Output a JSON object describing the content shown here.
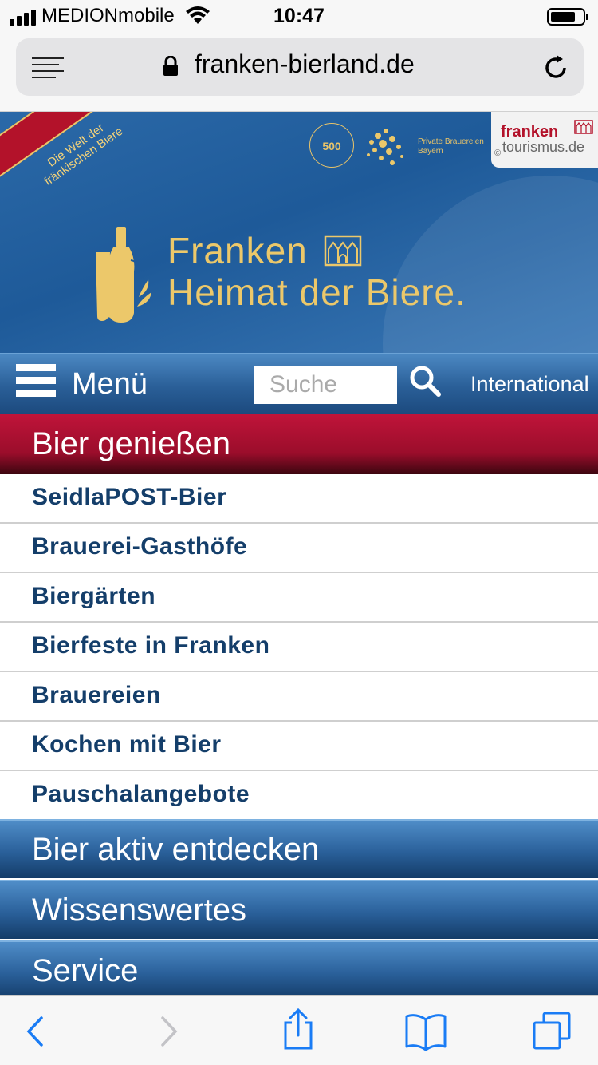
{
  "status_bar": {
    "carrier": "MEDIONmobile",
    "time": "10:47"
  },
  "browser": {
    "url": "franken-bierland.de"
  },
  "header": {
    "ribbon_line1": "Die Welt der",
    "ribbon_line2": "fränkischen Biere",
    "seal_number": "500",
    "brewers_line1": "Private Brauereien",
    "brewers_line2": "Bayern",
    "partner_line1": "franken",
    "partner_line2": "tourismus.de",
    "partner_copyright": "©",
    "title_line1": "Franken",
    "title_line2": "Heimat der Biere."
  },
  "nav": {
    "menu_label": "Menü",
    "search_placeholder": "Suche",
    "international_label": "International"
  },
  "active_section": "Bier genießen",
  "sub_items": [
    "SeidlaPOST-Bier",
    "Brauerei-Gasthöfe",
    "Biergärten",
    "Bierfeste in Franken",
    "Brauereien",
    "Kochen mit Bier",
    "Pauschalangebote"
  ],
  "sections": [
    "Bier aktiv entdecken",
    "Wissenswertes",
    "Service"
  ],
  "colors": {
    "accent_gold": "#ecc86a",
    "nav_blue": "#2a5f98",
    "active_red": "#b3122a",
    "link_navy": "#143e6a"
  }
}
